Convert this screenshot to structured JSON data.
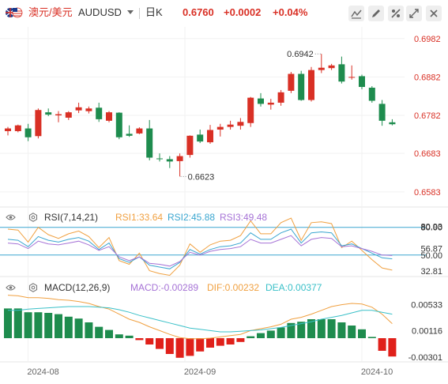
{
  "header": {
    "pair_cn": "澳元/美元",
    "symbol": "AUDUSD",
    "period": "日K",
    "price": "0.6760",
    "change": "+0.0002",
    "change_pct": "+0.04%"
  },
  "toolbar": [
    "draw-icon",
    "pencil-icon",
    "compare-icon",
    "fullscreen-icon",
    "close-icon"
  ],
  "indicators": {
    "rsi": {
      "label": "RSI(7,14,21)",
      "rsi1": "RSI1:33.64",
      "rsi2": "RSI2:45.88",
      "rsi3": "RSI3:49.48"
    },
    "macd": {
      "label": "MACD(12,26,9)",
      "macd": "MACD:-0.00289",
      "dif": "DIF:0.00232",
      "dea": "DEA:0.00377"
    }
  },
  "colors": {
    "up": "#d93025",
    "down": "#1e8c4e",
    "rsi1": "#f0a040",
    "rsi2": "#3aa6d0",
    "rsi3": "#a673d6",
    "dif": "#f0a040",
    "dea": "#3ac0c8"
  },
  "chart_data": [
    {
      "type": "candlestick",
      "title": "AUDUSD",
      "x_ticks": [
        "2024-08",
        "2024-09",
        "2024-10"
      ],
      "y_ticks": [
        "0.6982",
        "0.6882",
        "0.6782",
        "0.6683",
        "0.6583"
      ],
      "ylim": [
        0.656,
        0.7
      ],
      "annotations": [
        {
          "label": "0.6942",
          "price": 0.6942
        },
        {
          "label": "0.6623",
          "price": 0.6623
        }
      ],
      "last_price": 0.676,
      "candles": [
        {
          "o": 0.6741,
          "h": 0.6752,
          "l": 0.673,
          "c": 0.6748
        },
        {
          "o": 0.6741,
          "h": 0.6758,
          "l": 0.6738,
          "c": 0.6756
        },
        {
          "o": 0.6748,
          "h": 0.676,
          "l": 0.6715,
          "c": 0.6725
        },
        {
          "o": 0.6728,
          "h": 0.68,
          "l": 0.6722,
          "c": 0.6796
        },
        {
          "o": 0.679,
          "h": 0.68,
          "l": 0.678,
          "c": 0.6784
        },
        {
          "o": 0.6782,
          "h": 0.6793,
          "l": 0.6764,
          "c": 0.6785
        },
        {
          "o": 0.6776,
          "h": 0.6793,
          "l": 0.677,
          "c": 0.679
        },
        {
          "o": 0.6795,
          "h": 0.6815,
          "l": 0.6788,
          "c": 0.6803
        },
        {
          "o": 0.6793,
          "h": 0.6805,
          "l": 0.6787,
          "c": 0.68
        },
        {
          "o": 0.6802,
          "h": 0.6815,
          "l": 0.6765,
          "c": 0.6772
        },
        {
          "o": 0.6768,
          "h": 0.6793,
          "l": 0.6764,
          "c": 0.679
        },
        {
          "o": 0.6789,
          "h": 0.679,
          "l": 0.672,
          "c": 0.6725
        },
        {
          "o": 0.6734,
          "h": 0.6756,
          "l": 0.6726,
          "c": 0.6729
        },
        {
          "o": 0.6735,
          "h": 0.6751,
          "l": 0.6733,
          "c": 0.6748
        },
        {
          "o": 0.6748,
          "h": 0.677,
          "l": 0.6665,
          "c": 0.6672
        },
        {
          "o": 0.667,
          "h": 0.6683,
          "l": 0.6662,
          "c": 0.6669
        },
        {
          "o": 0.6668,
          "h": 0.6676,
          "l": 0.6645,
          "c": 0.6662
        },
        {
          "o": 0.6663,
          "h": 0.6683,
          "l": 0.6623,
          "c": 0.6676
        },
        {
          "o": 0.6679,
          "h": 0.673,
          "l": 0.6672,
          "c": 0.6729
        },
        {
          "o": 0.6732,
          "h": 0.6745,
          "l": 0.671,
          "c": 0.6714
        },
        {
          "o": 0.6712,
          "h": 0.6757,
          "l": 0.6708,
          "c": 0.6744
        },
        {
          "o": 0.6745,
          "h": 0.676,
          "l": 0.6727,
          "c": 0.6752
        },
        {
          "o": 0.6752,
          "h": 0.6768,
          "l": 0.6745,
          "c": 0.6758
        },
        {
          "o": 0.6755,
          "h": 0.6775,
          "l": 0.6745,
          "c": 0.6765
        },
        {
          "o": 0.6762,
          "h": 0.683,
          "l": 0.6752,
          "c": 0.6828
        },
        {
          "o": 0.6826,
          "h": 0.684,
          "l": 0.6805,
          "c": 0.6812
        },
        {
          "o": 0.681,
          "h": 0.6825,
          "l": 0.6797,
          "c": 0.6815
        },
        {
          "o": 0.6815,
          "h": 0.6848,
          "l": 0.6807,
          "c": 0.6842
        },
        {
          "o": 0.6846,
          "h": 0.6895,
          "l": 0.684,
          "c": 0.689
        },
        {
          "o": 0.689,
          "h": 0.6898,
          "l": 0.682,
          "c": 0.6822
        },
        {
          "o": 0.6822,
          "h": 0.6908,
          "l": 0.6818,
          "c": 0.69
        },
        {
          "o": 0.69,
          "h": 0.6942,
          "l": 0.6892,
          "c": 0.6906
        },
        {
          "o": 0.6905,
          "h": 0.6916,
          "l": 0.69,
          "c": 0.6912
        },
        {
          "o": 0.6915,
          "h": 0.6935,
          "l": 0.6865,
          "c": 0.687
        },
        {
          "o": 0.688,
          "h": 0.6912,
          "l": 0.6875,
          "c": 0.6882
        },
        {
          "o": 0.6884,
          "h": 0.6888,
          "l": 0.685,
          "c": 0.6856
        },
        {
          "o": 0.6854,
          "h": 0.6858,
          "l": 0.6815,
          "c": 0.682
        },
        {
          "o": 0.6812,
          "h": 0.6822,
          "l": 0.6755,
          "c": 0.6768
        },
        {
          "o": 0.6764,
          "h": 0.6772,
          "l": 0.6756,
          "c": 0.676
        }
      ]
    },
    {
      "type": "line",
      "title": "RSI(7,14,21)",
      "y_ticks": [
        "80.00",
        "80.93",
        "56.87",
        "50.00",
        "32.81"
      ],
      "hlines": [
        80,
        50
      ],
      "ylim": [
        25,
        90
      ],
      "series": [
        {
          "name": "RSI1",
          "values": [
            78,
            77,
            64,
            80,
            72,
            68,
            73,
            76,
            70,
            58,
            69,
            44,
            40,
            52,
            33,
            30,
            28,
            39,
            62,
            53,
            61,
            65,
            66,
            71,
            87,
            73,
            73,
            85,
            90,
            66,
            85,
            86,
            84,
            58,
            65,
            55,
            45,
            36,
            33.6
          ]
        },
        {
          "name": "RSI2",
          "values": [
            67,
            66,
            59,
            70,
            66,
            64,
            67,
            69,
            65,
            56,
            63,
            46,
            42,
            48,
            39,
            37,
            35,
            42,
            56,
            51,
            56,
            59,
            60,
            63,
            74,
            67,
            67,
            74,
            78,
            63,
            74,
            75,
            74,
            60,
            62,
            57,
            52,
            47,
            45.9
          ]
        },
        {
          "name": "RSI3",
          "values": [
            63,
            62,
            57,
            65,
            62,
            61,
            63,
            65,
            61,
            55,
            59,
            48,
            44,
            48,
            41,
            40,
            38,
            43,
            53,
            50,
            54,
            56,
            57,
            59,
            67,
            63,
            63,
            67,
            71,
            60,
            67,
            69,
            68,
            59,
            60,
            57,
            54,
            50,
            49.5
          ]
        }
      ]
    },
    {
      "type": "bar",
      "title": "MACD(12,26,9)",
      "y_ticks": [
        "0.00533",
        "0.00116",
        "-0.00301"
      ],
      "ylim": [
        -0.0035,
        0.007
      ],
      "series": [
        {
          "name": "MACD",
          "values": [
            0.0047,
            0.0047,
            0.0041,
            0.0041,
            0.004,
            0.0038,
            0.0034,
            0.0031,
            0.0025,
            0.0018,
            0.0013,
            0.0006,
            0.0004,
            -0.0003,
            -0.001,
            -0.0017,
            -0.0025,
            -0.0031,
            -0.0028,
            -0.0021,
            -0.0015,
            -0.0012,
            -0.001,
            -0.0006,
            0.0003,
            0.0008,
            0.0012,
            0.0017,
            0.0024,
            0.0026,
            0.003,
            0.003,
            0.003,
            0.0025,
            0.002,
            0.0014,
            0.0002,
            -0.002,
            -0.0029
          ]
        },
        {
          "name": "DIF",
          "values": [
            0.0068,
            0.0067,
            0.0064,
            0.0064,
            0.0063,
            0.0061,
            0.006,
            0.0058,
            0.0055,
            0.005,
            0.0046,
            0.0038,
            0.003,
            0.0025,
            0.0018,
            0.0012,
            0.0006,
            0.0001,
            -0.0001,
            -0.0001,
            0.0,
            0.0002,
            0.0004,
            0.0006,
            0.0012,
            0.0015,
            0.0018,
            0.0022,
            0.003,
            0.0033,
            0.0038,
            0.0044,
            0.005,
            0.0053,
            0.0055,
            0.0054,
            0.0049,
            0.0038,
            0.0023
          ]
        },
        {
          "name": "DEA",
          "values": [
            0.0044,
            0.0044,
            0.0046,
            0.0047,
            0.0048,
            0.0049,
            0.005,
            0.005,
            0.005,
            0.0049,
            0.0048,
            0.0045,
            0.0041,
            0.0036,
            0.0032,
            0.0028,
            0.0024,
            0.002,
            0.0016,
            0.0014,
            0.0012,
            0.001,
            0.001,
            0.0011,
            0.0012,
            0.0013,
            0.0015,
            0.0017,
            0.002,
            0.0023,
            0.0026,
            0.003,
            0.0033,
            0.0036,
            0.004,
            0.0044,
            0.0044,
            0.0041,
            0.0038
          ]
        }
      ]
    }
  ]
}
